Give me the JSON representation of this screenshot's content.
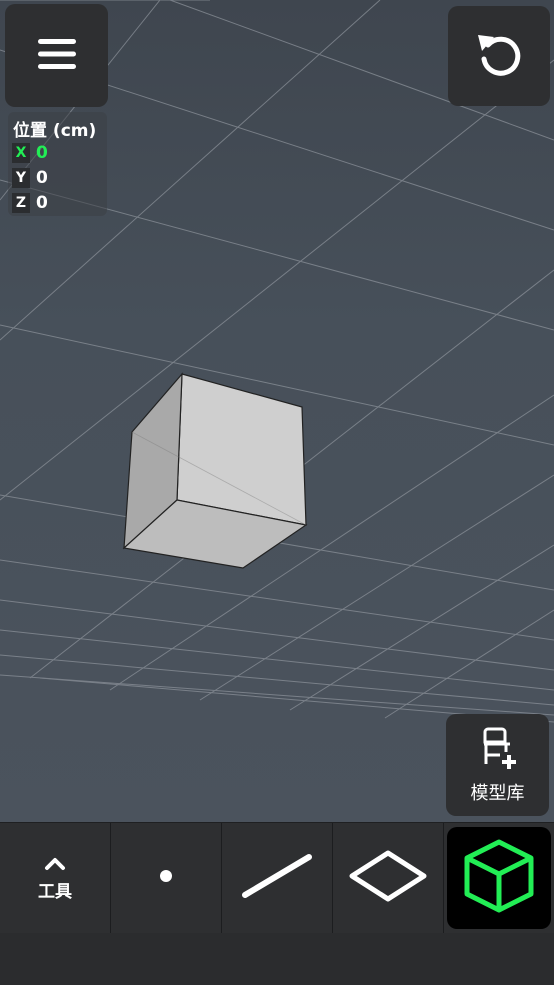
{
  "viewport": {
    "position_panel": {
      "title": "位置 (cm)",
      "axes": [
        {
          "label": "X",
          "value": "0",
          "active": true
        },
        {
          "label": "Y",
          "value": "0",
          "active": false
        },
        {
          "label": "Z",
          "value": "0",
          "active": false
        }
      ]
    },
    "top_left_button": {
      "icon": "hamburger-menu-icon"
    },
    "top_right_button": {
      "icon": "undo-icon"
    },
    "model_library": {
      "label": "模型库",
      "icon": "chair-add-icon"
    }
  },
  "toolbar": {
    "tools": [
      {
        "id": "tools",
        "label": "工具",
        "icon": "chevron-up-icon"
      },
      {
        "id": "point",
        "icon": "point-icon"
      },
      {
        "id": "line",
        "icon": "line-icon"
      },
      {
        "id": "face",
        "icon": "diamond-face-icon"
      },
      {
        "id": "solid",
        "icon": "cube-icon",
        "selected": true
      }
    ]
  },
  "colors": {
    "accent": "#22ee55",
    "panel": "#2e2f31",
    "scene_background": "#454c55"
  }
}
